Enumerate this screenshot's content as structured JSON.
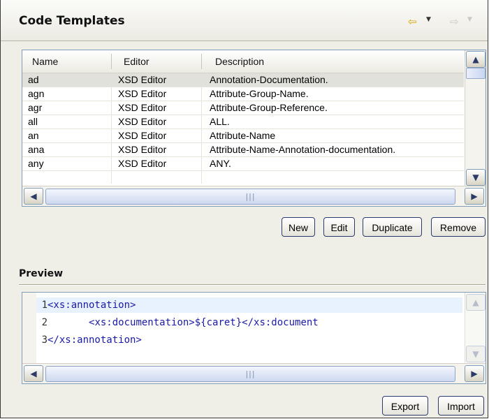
{
  "header": {
    "title": "Code Templates",
    "back_icon": "back-arrow-icon",
    "forward_icon": "forward-arrow-icon"
  },
  "table": {
    "columns": [
      "Name",
      "Editor",
      "Description"
    ],
    "rows": [
      {
        "name": "ad",
        "editor": "XSD Editor",
        "description": "Annotation-Documentation."
      },
      {
        "name": "agn",
        "editor": "XSD Editor",
        "description": "Attribute-Group-Name."
      },
      {
        "name": "agr",
        "editor": "XSD Editor",
        "description": "Attribute-Group-Reference."
      },
      {
        "name": "all",
        "editor": "XSD Editor",
        "description": "ALL."
      },
      {
        "name": "an",
        "editor": "XSD Editor",
        "description": "Attribute-Name"
      },
      {
        "name": "ana",
        "editor": "XSD Editor",
        "description": "Attribute-Name-Annotation-documentation."
      },
      {
        "name": "any",
        "editor": "XSD Editor",
        "description": "ANY."
      }
    ],
    "selected_row": 0
  },
  "buttons": {
    "new": "New",
    "edit": "Edit",
    "duplicate": "Duplicate",
    "remove": "Remove",
    "export": "Export",
    "import": "Import"
  },
  "preview": {
    "label": "Preview",
    "lines": [
      {
        "num": "1",
        "indent": "",
        "code": "<xs:annotation>"
      },
      {
        "num": "2",
        "indent": "       ",
        "code": "<xs:documentation>${caret}</xs:document"
      },
      {
        "num": "3",
        "indent": "",
        "code": "</xs:annotation>"
      }
    ]
  },
  "colors": {
    "tag": "#1a1aa8",
    "current_line": "#e8f2fe",
    "selected_row": "#e1e1dc",
    "back_arrow": "#d9a400"
  }
}
